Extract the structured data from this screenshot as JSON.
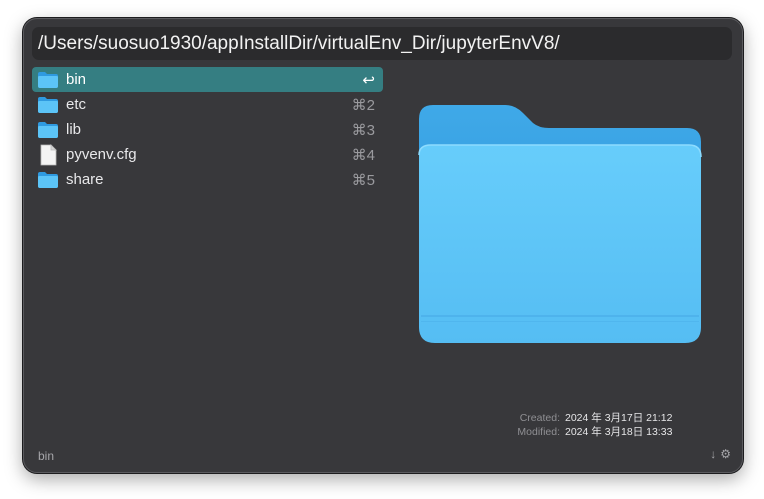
{
  "search": {
    "value": "/Users/suosuo1930/appInstallDir/virtualEnv_Dir/jupyterEnvV8/"
  },
  "results": [
    {
      "label": "bin",
      "shortcut": "↩",
      "icon": "folder-icon",
      "selected": true
    },
    {
      "label": "etc",
      "shortcut": "⌘2",
      "icon": "folder-icon",
      "selected": false
    },
    {
      "label": "lib",
      "shortcut": "⌘3",
      "icon": "folder-icon",
      "selected": false
    },
    {
      "label": "pyvenv.cfg",
      "shortcut": "⌘4",
      "icon": "document-icon",
      "selected": false
    },
    {
      "label": "share",
      "shortcut": "⌘5",
      "icon": "folder-icon",
      "selected": false
    }
  ],
  "preview": {
    "icon": "large-folder-icon",
    "created_label": "Created:",
    "created_value": "2024 年 3月17日 21:12",
    "modified_label": "Modified:",
    "modified_value": "2024 年 3月18日 13:33"
  },
  "footer": {
    "selected_name": "bin",
    "sort_icon": "↓",
    "settings_icon": "⚙"
  },
  "colors": {
    "window_bg": "#38383b",
    "selection": "#357e82",
    "folder_blue": "#3aa6e6"
  }
}
